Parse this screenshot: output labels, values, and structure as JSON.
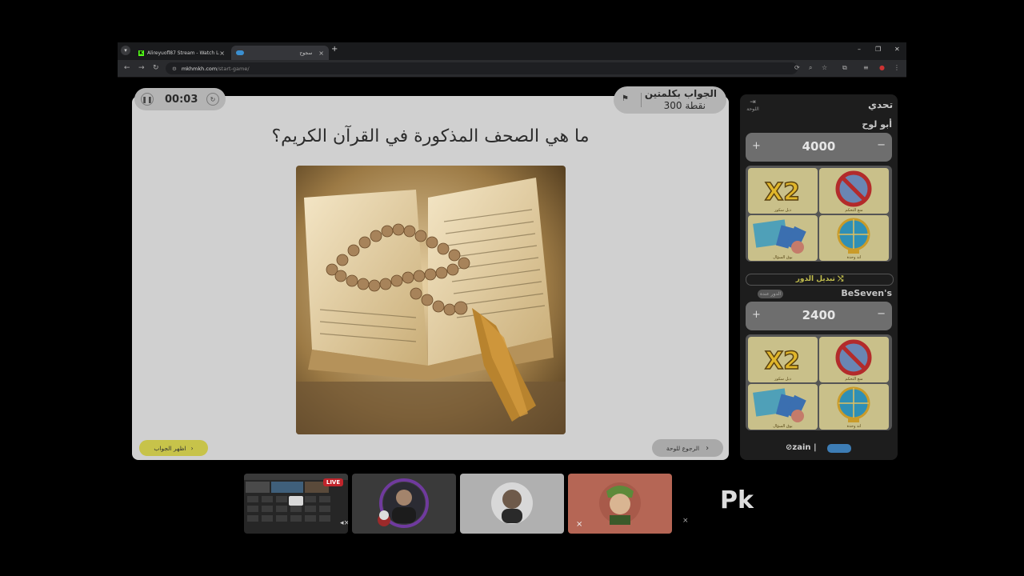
{
  "browser": {
    "tabs": [
      {
        "label": "Alireyuofl87 Stream - Watch Li",
        "active": false
      },
      {
        "label": "سجوح",
        "active": true
      }
    ],
    "url_host": "mkhmkh.com",
    "url_path": "/start-game/"
  },
  "game": {
    "timer": "00:03",
    "category": "الجواب بكلمتين",
    "points": "300 نقطة",
    "question": "ما هي الصحف المذكورة في القرآن الكريم؟",
    "show_answer_label": "اظهر الجواب",
    "back_label": "الرجوع للوحة"
  },
  "side": {
    "mode": "تحدي",
    "board_label": "اللوحة",
    "swap_label": "تبديل الدور",
    "turn_badge": "الدور عنده",
    "teams": [
      {
        "name": "أبو لوح",
        "score": "4000"
      },
      {
        "name": "BeSeven's",
        "score": "2400"
      }
    ],
    "helpers": [
      "دبل سكور",
      "منع التحكم",
      "بوق السؤال",
      "اند وحدة"
    ],
    "sponsor": "zain"
  },
  "call": {
    "live_label": "LIVE",
    "brand": "Pk"
  },
  "colors": {
    "accent_yellow": "#c7c34a",
    "live_red": "#c0242b",
    "panel_dark": "#1d1d1d"
  }
}
